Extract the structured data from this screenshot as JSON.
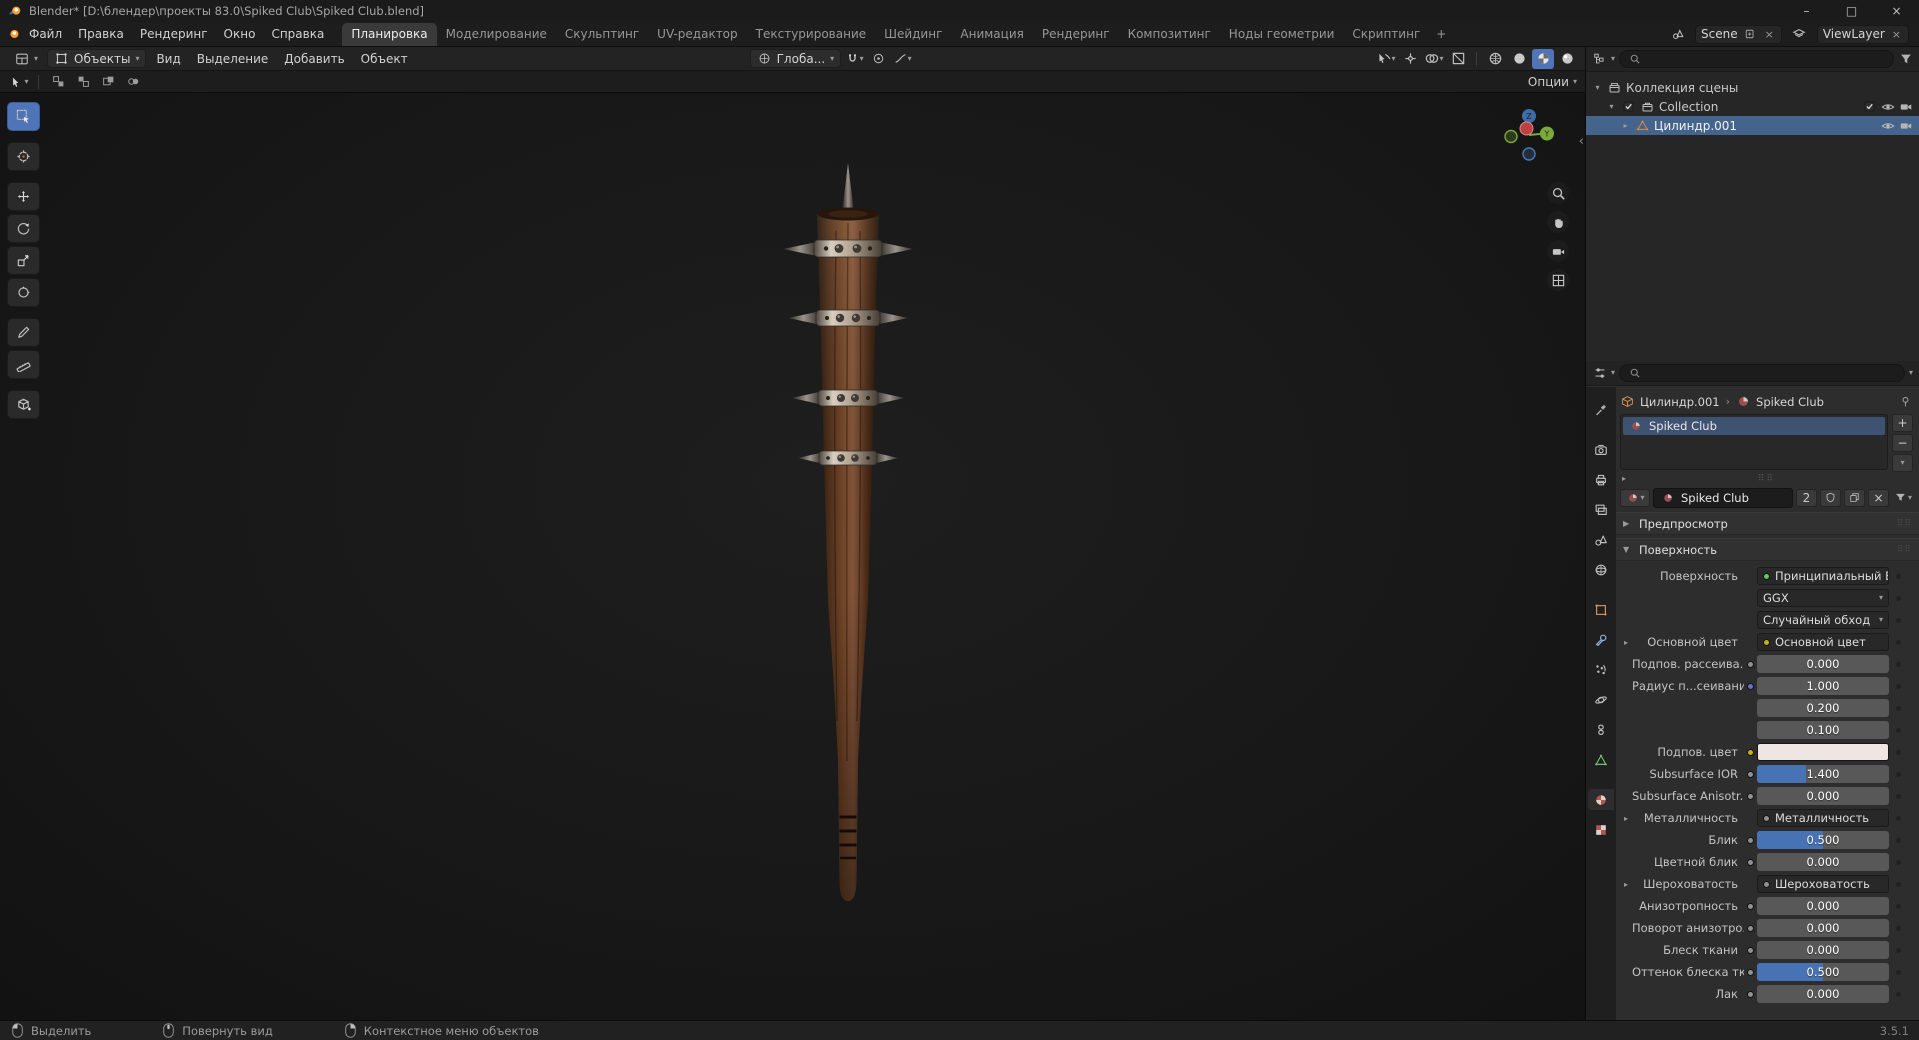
{
  "colors": {
    "accent": "#4772b3",
    "active_tool": "#4f74b8",
    "selected_row": "#44648c"
  },
  "window": {
    "title": "Blender* [D:\\блендер\\проекты 83.0\\Spiked Club\\Spiked Club.blend]",
    "minimize": "–",
    "maximize": "□",
    "close": "×"
  },
  "topbar": {
    "menus": [
      "Файл",
      "Правка",
      "Рендеринг",
      "Окно",
      "Справка"
    ],
    "workspaces": [
      "Планировка",
      "Моделирование",
      "Скульптинг",
      "UV-редактор",
      "Текстурирование",
      "Шейдинг",
      "Анимация",
      "Рендеринг",
      "Композитинг",
      "Ноды геометрии",
      "Скриптинг"
    ],
    "active_workspace": "Планировка",
    "add_tab": "+",
    "scene_label": "Scene",
    "viewlayer_label": "ViewLayer"
  },
  "viewport": {
    "header": {
      "mode": "Объекты",
      "menus": [
        "Вид",
        "Выделение",
        "Добавить",
        "Объект"
      ],
      "orientation": "Глоба...",
      "right_icons": [
        "editor-visibility",
        "show-gizmos",
        "show-overlays",
        "toggle-xray",
        "shading-wireframe",
        "shading-solid",
        "shading-material-preview",
        "shading-rendered"
      ],
      "active_shading": "shading-material-preview"
    },
    "tool_settings": {
      "options_label": "Опции"
    },
    "tools": [
      {
        "name": "select-box-tool",
        "active": true
      },
      {
        "name": "cursor-tool"
      },
      {
        "name": "move-tool"
      },
      {
        "name": "rotate-tool"
      },
      {
        "name": "scale-tool"
      },
      {
        "name": "transform-tool"
      },
      {
        "name": "annotate-tool"
      },
      {
        "name": "measure-tool"
      },
      {
        "name": "add-cube-tool"
      }
    ],
    "nav_icons": [
      "zoom-icon",
      "pan-icon",
      "camera-view-icon",
      "ortho-grid-icon"
    ]
  },
  "outliner": {
    "rows": [
      {
        "label": "Коллекция сцены",
        "icon": "scene-collection-icon",
        "level": 0,
        "arrow": "▾",
        "right": []
      },
      {
        "label": "Collection",
        "icon": "collection-icon",
        "level": 1,
        "arrow": "▾",
        "checkbox": true,
        "right": [
          "checkbox",
          "eye",
          "camera"
        ]
      },
      {
        "label": "Цилиндр.001",
        "icon": "mesh-icon",
        "level": 2,
        "arrow": "▸",
        "selected": true,
        "right": [
          "eye",
          "camera"
        ]
      }
    ]
  },
  "properties": {
    "tabs": [
      "tool",
      "render",
      "output",
      "view-layer",
      "scene",
      "world",
      "object",
      "modifiers",
      "particles",
      "physics",
      "constraints",
      "object-data",
      "material",
      "texture"
    ],
    "active_tab": "material",
    "breadcrumb": {
      "object": "Цилиндр.001",
      "material": "Spiked Club"
    },
    "slot_name": "Spiked Club",
    "material_name": "Spiked Club",
    "users_count": "2",
    "preview_section": "Предпросмотр",
    "surface_section": "Поверхность",
    "rows": [
      {
        "label": "Поверхность",
        "type": "link",
        "value": "Принципиальный BSDF",
        "dot": "#63c763"
      },
      {
        "label": "",
        "type": "menu",
        "value": "GGX",
        "caret": true
      },
      {
        "label": "",
        "type": "menu",
        "value": "Случайный обход",
        "caret": true
      },
      {
        "label": "Основной цвет",
        "expander": true,
        "type": "link",
        "value": "Основной цвет",
        "dot": "#c8b400"
      },
      {
        "label": "Подпов. рассеива...",
        "type": "number",
        "value": "0.000",
        "socket": "#919191"
      },
      {
        "label": "Радиус п...сеивания",
        "type": "number",
        "value": "1.000",
        "socket": "#6e6ecb"
      },
      {
        "label": "",
        "type": "number",
        "value": "0.200"
      },
      {
        "label": "",
        "type": "number",
        "value": "0.100"
      },
      {
        "label": "Подпов. цвет",
        "type": "color",
        "value": "#efe6e3",
        "socket": "#c8b400"
      },
      {
        "label": "Subsurface IOR",
        "type": "slider",
        "value": "1.400",
        "fill": 0.37,
        "socket": "#919191"
      },
      {
        "label": "Subsurface Anisotr...",
        "type": "number",
        "value": "0.000",
        "socket": "#919191"
      },
      {
        "label": "Металличность",
        "expander": true,
        "type": "link",
        "value": "Металличность",
        "dot": "#919191"
      },
      {
        "label": "Блик",
        "type": "slider",
        "value": "0.500",
        "fill": 0.5,
        "socket": "#919191"
      },
      {
        "label": "Цветной блик",
        "type": "number",
        "value": "0.000",
        "socket": "#919191"
      },
      {
        "label": "Шероховатость",
        "expander": true,
        "type": "link",
        "value": "Шероховатость",
        "dot": "#919191"
      },
      {
        "label": "Анизотропность",
        "type": "number",
        "value": "0.000",
        "socket": "#919191"
      },
      {
        "label": "Поворот анизотро...",
        "type": "number",
        "value": "0.000",
        "socket": "#919191"
      },
      {
        "label": "Блеск ткани",
        "type": "number",
        "value": "0.000",
        "socket": "#919191"
      },
      {
        "label": "Оттенок блеска тк...",
        "type": "slider",
        "value": "0.500",
        "fill": 0.5,
        "socket": "#919191"
      },
      {
        "label": "Лак",
        "type": "number",
        "value": "0.000",
        "socket": "#919191"
      }
    ]
  },
  "statusbar": {
    "items": [
      {
        "icon": "mouse-left-icon",
        "label": "Выделить"
      },
      {
        "icon": "mouse-middle-icon",
        "label": "Повернуть вид"
      },
      {
        "icon": "mouse-right-icon",
        "label": "Контекстное меню объектов"
      }
    ],
    "version": "3.5.1"
  }
}
